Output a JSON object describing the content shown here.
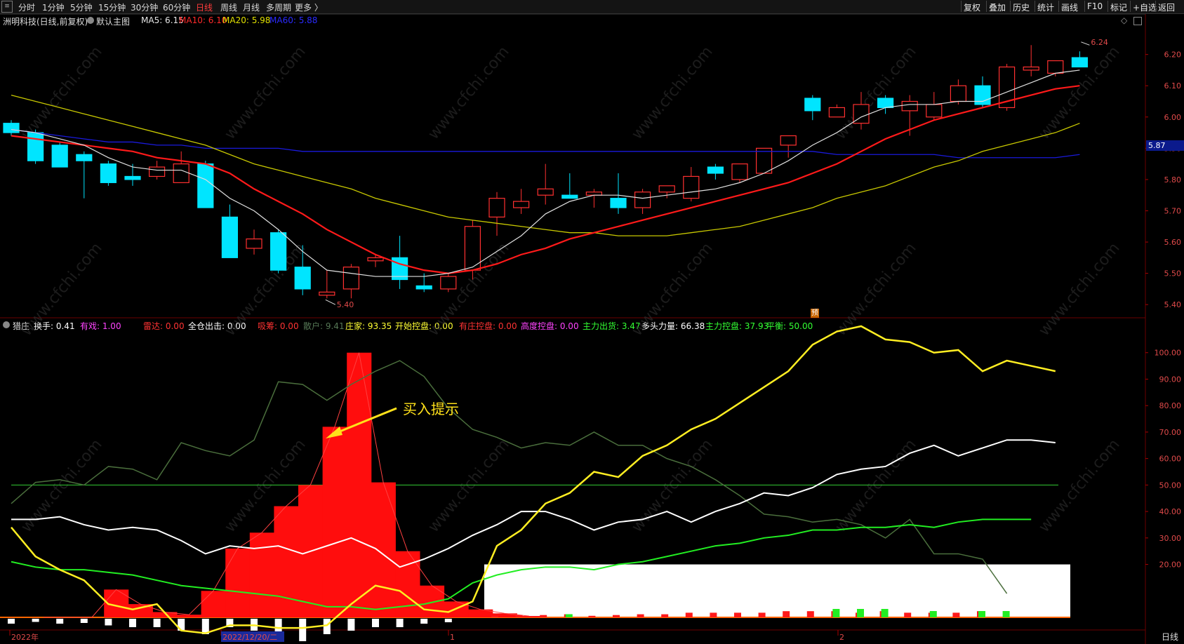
{
  "toolbar": {
    "left": [
      "分时",
      "1分钟",
      "5分钟",
      "15分钟",
      "30分钟",
      "60分钟",
      "日线",
      "周线",
      "月线",
      "多周期",
      "更多 〉"
    ],
    "active_index": 6,
    "right": [
      "复权",
      "叠加",
      "历史",
      "统计",
      "画线",
      "F10",
      "标记",
      "+自选",
      "返回"
    ]
  },
  "main_info": {
    "stock": "洲明科技(日线,前复权)",
    "template": "默认主图",
    "ma5": "MA5: 6.15",
    "ma10": "MA10: 6.10",
    "ma20": "MA20: 5.98",
    "ma60": "MA60: 5.88"
  },
  "sub_info": {
    "name": "猎庄",
    "items": [
      {
        "text": "换手: 0.41",
        "color": "#ffffff"
      },
      {
        "text": "有戏: 1.00",
        "color": "#ff44ff"
      },
      {
        "text": "雷达: 0.00",
        "color": "#ff3333"
      },
      {
        "text": "全仓出击: 0.00",
        "color": "#ffffff"
      },
      {
        "text": "吸筹: 0.00",
        "color": "#ff3333"
      },
      {
        "text": "散户: 9.41",
        "color": "#557755"
      },
      {
        "text": "庄家: 93.35",
        "color": "#ffff33"
      },
      {
        "text": "开始控盘: 0.00",
        "color": "#ffff33"
      },
      {
        "text": "有庄控盘: 0.00",
        "color": "#ff3333"
      },
      {
        "text": "高度控盘: 0.00",
        "color": "#ff44ff"
      },
      {
        "text": "主力出货: 3.47",
        "color": "#33ff33"
      },
      {
        "text": "多头力量: 66.38",
        "color": "#ffffff"
      },
      {
        "text": "主力控盘: 37.93",
        "color": "#33ff33"
      },
      {
        "text": "平衡: 50.00",
        "color": "#33ff33"
      }
    ]
  },
  "price_axis": [
    "6.20",
    "6.10",
    "6.00",
    "5.90",
    "5.80",
    "5.70",
    "5.60",
    "5.50",
    "5.40"
  ],
  "current_price": "5.87",
  "high_label": "6.24",
  "low_label": "5.40",
  "sub_axis": [
    "100.00",
    "90.00",
    "80.00",
    "70.00",
    "60.00",
    "50.00",
    "40.00",
    "30.00",
    "20.00"
  ],
  "dates": [
    "2022年",
    "2022/12/20/二",
    "1",
    "2"
  ],
  "bottom_tab": "日线",
  "buy_tip": "买入提示",
  "badge": "预",
  "watermark": "www.cfchi.com",
  "colors": {
    "up": "#ff3030",
    "down": "#00e5ff",
    "ma5": "#e0e0e0",
    "ma10": "#ff1a1a",
    "ma20": "#c8c800",
    "ma60": "#1a1adc"
  },
  "chart_data": [
    {
      "type": "candlestick",
      "ohlc": [
        [
          5.98,
          5.99,
          5.94,
          5.95
        ],
        [
          5.95,
          5.96,
          5.85,
          5.86
        ],
        [
          5.91,
          5.92,
          5.84,
          5.84
        ],
        [
          5.88,
          5.89,
          5.74,
          5.86
        ],
        [
          5.85,
          5.86,
          5.78,
          5.79
        ],
        [
          5.81,
          5.85,
          5.78,
          5.8
        ],
        [
          5.81,
          5.86,
          5.8,
          5.84
        ],
        [
          5.79,
          5.89,
          5.79,
          5.85
        ],
        [
          5.85,
          5.86,
          5.71,
          5.71
        ],
        [
          5.68,
          5.72,
          5.55,
          5.55
        ],
        [
          5.58,
          5.64,
          5.56,
          5.61
        ],
        [
          5.63,
          5.64,
          5.5,
          5.51
        ],
        [
          5.52,
          5.59,
          5.43,
          5.45
        ],
        [
          5.43,
          5.51,
          5.42,
          5.44
        ],
        [
          5.45,
          5.53,
          5.42,
          5.52
        ],
        [
          5.54,
          5.56,
          5.52,
          5.55
        ],
        [
          5.55,
          5.62,
          5.45,
          5.48
        ],
        [
          5.46,
          5.5,
          5.44,
          5.45
        ],
        [
          5.45,
          5.5,
          5.44,
          5.49
        ],
        [
          5.51,
          5.67,
          5.48,
          5.65
        ],
        [
          5.68,
          5.76,
          5.62,
          5.74
        ],
        [
          5.71,
          5.77,
          5.69,
          5.73
        ],
        [
          5.75,
          5.85,
          5.72,
          5.77
        ],
        [
          5.75,
          5.82,
          5.74,
          5.74
        ],
        [
          5.75,
          5.77,
          5.71,
          5.76
        ],
        [
          5.74,
          5.82,
          5.69,
          5.71
        ],
        [
          5.71,
          5.77,
          5.69,
          5.76
        ],
        [
          5.76,
          5.78,
          5.74,
          5.78
        ],
        [
          5.74,
          5.84,
          5.73,
          5.81
        ],
        [
          5.84,
          5.85,
          5.8,
          5.82
        ],
        [
          5.8,
          5.85,
          5.79,
          5.85
        ],
        [
          5.82,
          5.9,
          5.82,
          5.9
        ],
        [
          5.91,
          5.94,
          5.87,
          5.94
        ],
        [
          6.06,
          6.07,
          5.99,
          6.02
        ],
        [
          6.0,
          6.04,
          6.0,
          6.03
        ],
        [
          5.98,
          6.08,
          5.96,
          6.04
        ],
        [
          6.06,
          6.07,
          6.01,
          6.03
        ],
        [
          6.02,
          6.07,
          5.94,
          6.05
        ],
        [
          6.0,
          6.08,
          5.99,
          6.04
        ],
        [
          6.05,
          6.12,
          6.04,
          6.1
        ],
        [
          6.1,
          6.13,
          6.03,
          6.04
        ],
        [
          6.03,
          6.17,
          6.02,
          6.16
        ],
        [
          6.15,
          6.23,
          6.13,
          6.16
        ],
        [
          6.14,
          6.18,
          6.13,
          6.18
        ],
        [
          6.19,
          6.21,
          6.17,
          6.16
        ]
      ],
      "ma5": [
        5.96,
        5.95,
        5.93,
        5.91,
        5.87,
        5.84,
        5.83,
        5.83,
        5.8,
        5.74,
        5.7,
        5.64,
        5.57,
        5.51,
        5.5,
        5.49,
        5.49,
        5.49,
        5.5,
        5.52,
        5.57,
        5.62,
        5.69,
        5.73,
        5.75,
        5.75,
        5.74,
        5.75,
        5.76,
        5.77,
        5.79,
        5.82,
        5.86,
        5.91,
        5.95,
        6.0,
        6.03,
        6.04,
        6.04,
        6.05,
        6.05,
        6.08,
        6.11,
        6.14,
        6.15
      ],
      "ma10": [
        5.94,
        5.93,
        5.92,
        5.91,
        5.9,
        5.89,
        5.87,
        5.86,
        5.85,
        5.82,
        5.77,
        5.73,
        5.69,
        5.64,
        5.6,
        5.56,
        5.53,
        5.51,
        5.5,
        5.51,
        5.53,
        5.56,
        5.58,
        5.61,
        5.63,
        5.65,
        5.67,
        5.69,
        5.71,
        5.73,
        5.75,
        5.77,
        5.79,
        5.82,
        5.85,
        5.89,
        5.93,
        5.96,
        5.99,
        6.01,
        6.03,
        6.05,
        6.07,
        6.09,
        6.1
      ],
      "ma20": [
        6.07,
        6.05,
        6.03,
        6.01,
        5.99,
        5.97,
        5.95,
        5.93,
        5.91,
        5.88,
        5.85,
        5.83,
        5.81,
        5.79,
        5.77,
        5.74,
        5.72,
        5.7,
        5.68,
        5.67,
        5.66,
        5.65,
        5.64,
        5.63,
        5.63,
        5.62,
        5.62,
        5.62,
        5.63,
        5.64,
        5.65,
        5.67,
        5.69,
        5.71,
        5.74,
        5.76,
        5.78,
        5.81,
        5.84,
        5.86,
        5.89,
        5.91,
        5.93,
        5.95,
        5.98
      ],
      "ma60": [
        5.96,
        5.95,
        5.94,
        5.93,
        5.92,
        5.92,
        5.91,
        5.91,
        5.9,
        5.9,
        5.9,
        5.9,
        5.89,
        5.89,
        5.89,
        5.89,
        5.89,
        5.89,
        5.89,
        5.89,
        5.89,
        5.89,
        5.89,
        5.89,
        5.89,
        5.89,
        5.89,
        5.89,
        5.89,
        5.89,
        5.89,
        5.89,
        5.89,
        5.89,
        5.88,
        5.88,
        5.88,
        5.88,
        5.88,
        5.87,
        5.87,
        5.87,
        5.87,
        5.87,
        5.88
      ],
      "ylim": [
        5.36,
        6.28
      ]
    },
    {
      "type": "indicator",
      "ylim": [
        0,
        110
      ],
      "balance": 50,
      "red_bars": [
        0,
        0,
        0,
        10.5,
        5,
        2,
        1,
        10,
        26,
        32,
        42,
        50,
        72,
        100,
        51,
        25,
        12,
        6,
        3,
        1.5,
        0.5
      ],
      "green_dark": [
        43,
        51,
        52,
        50,
        57,
        56,
        52,
        66,
        63,
        61,
        67,
        89,
        88,
        82,
        88,
        93,
        97,
        91,
        79,
        71,
        68,
        64,
        66,
        65,
        70,
        65,
        65,
        60,
        57,
        52,
        46,
        39,
        38,
        36,
        37,
        35,
        30,
        37,
        24,
        24,
        22,
        9
      ],
      "white": [
        37,
        37,
        38,
        35,
        33,
        34,
        33,
        29,
        24,
        27,
        26,
        27,
        24,
        27,
        30,
        26,
        19,
        22,
        26,
        31,
        35,
        40,
        40,
        37,
        33,
        36,
        37,
        40,
        36,
        40,
        43,
        47,
        46,
        49,
        54,
        56,
        57,
        62,
        65,
        61,
        64,
        67,
        67,
        66
      ],
      "bright_green": [
        21,
        19,
        18,
        18,
        17,
        16,
        14,
        12,
        11,
        10,
        9,
        8,
        6,
        4,
        4,
        3,
        4,
        5,
        7,
        13,
        16,
        18,
        19,
        19,
        18,
        20,
        21,
        23,
        25,
        27,
        28,
        30,
        31,
        33,
        33,
        34,
        34,
        35,
        34,
        36,
        37,
        37,
        37
      ],
      "yellow": [
        34,
        23,
        18,
        14,
        5,
        3,
        5,
        -5,
        -6,
        -3,
        -3,
        -4,
        -4,
        -3,
        5,
        12,
        10,
        3,
        2,
        6,
        27,
        33,
        43,
        47,
        55,
        53,
        61,
        65,
        71,
        75,
        81,
        87,
        93,
        103,
        108,
        110,
        105,
        104,
        100,
        101,
        93,
        97,
        95,
        93
      ],
      "bottom_white_bars": [
        1,
        0.5,
        1,
        0.8,
        1.5,
        2,
        2,
        3,
        4,
        2,
        3,
        5,
        6,
        4,
        3,
        2,
        2,
        1,
        0.6
      ],
      "red_small_bars": [
        1,
        1.5,
        1.5,
        2,
        1,
        1.5,
        2,
        2,
        3,
        3,
        3,
        3,
        4,
        4,
        4,
        3,
        4,
        3,
        3,
        3,
        4
      ],
      "green_small_bars": [
        0,
        0,
        0,
        1.5,
        0,
        0,
        0,
        0,
        0,
        0,
        0,
        0,
        0,
        0,
        4,
        4,
        4,
        0,
        3,
        0,
        3,
        3
      ]
    }
  ]
}
